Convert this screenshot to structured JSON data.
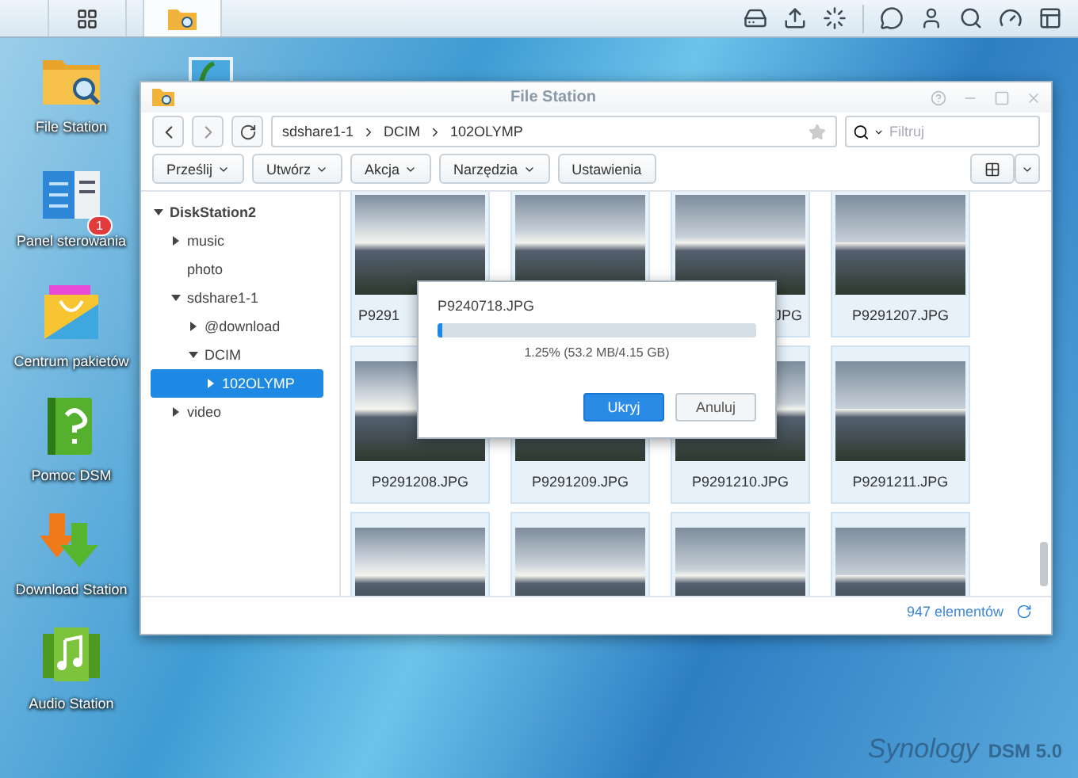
{
  "taskbar": {
    "apps": [
      {
        "kind": "main_menu",
        "selected": false
      },
      {
        "kind": "file_station",
        "selected": true
      }
    ]
  },
  "desktop_icons": [
    {
      "kind": "folder",
      "label": "File Station"
    },
    {
      "kind": "control_panel",
      "label": "Panel sterowania",
      "badge": "1"
    },
    {
      "kind": "package",
      "label": "Centrum pakietów"
    },
    {
      "kind": "help",
      "label": "Pomoc DSM"
    },
    {
      "kind": "download",
      "label": "Download Station"
    },
    {
      "kind": "audio",
      "label": "Audio Station"
    }
  ],
  "window": {
    "title": "File Station",
    "path": [
      "sdshare1-1",
      "DCIM",
      "102OLYMP"
    ],
    "search": {
      "placeholder": "Filtruj"
    },
    "toolbar": [
      {
        "label": "Prześlij",
        "dropdown": true
      },
      {
        "label": "Utwórz",
        "dropdown": true
      },
      {
        "label": "Akcja",
        "dropdown": true
      },
      {
        "label": "Narzędzia",
        "dropdown": true
      },
      {
        "label": "Ustawienia",
        "dropdown": false
      }
    ],
    "tree": [
      {
        "label": "DiskStation2",
        "kind": "branch",
        "expanded": true,
        "selected": false,
        "children": [
          {
            "label": "music",
            "kind": "branch",
            "expanded": false,
            "selected": false
          },
          {
            "label": "photo",
            "kind": "leaf",
            "expanded": false,
            "selected": false
          },
          {
            "label": "sdshare1-1",
            "kind": "branch",
            "expanded": true,
            "selected": false,
            "children": [
              {
                "label": "@download",
                "kind": "branch",
                "expanded": false,
                "selected": false
              },
              {
                "label": "DCIM",
                "kind": "branch",
                "expanded": true,
                "selected": false,
                "children": [
                  {
                    "label": "102OLYMP",
                    "kind": "branch",
                    "expanded": false,
                    "selected": true
                  }
                ]
              }
            ]
          },
          {
            "label": "video",
            "kind": "branch",
            "expanded": false,
            "selected": false
          }
        ]
      }
    ],
    "files": [
      {
        "kind": "start",
        "label": "P9291"
      },
      {
        "kind": "none"
      },
      {
        "kind": "end",
        "label": "JPG"
      },
      {
        "kind": "full",
        "label": "P9291207.JPG"
      },
      {
        "kind": "full",
        "label": "P9291208.JPG"
      },
      {
        "kind": "full",
        "label": "P9291209.JPG"
      },
      {
        "kind": "full",
        "label": "P9291210.JPG"
      },
      {
        "kind": "full",
        "label": "P9291211.JPG"
      },
      {
        "kind": "none"
      },
      {
        "kind": "none"
      },
      {
        "kind": "none"
      },
      {
        "kind": "none"
      }
    ],
    "status": "947 elementów",
    "dialog": {
      "file": "P9240718.JPG",
      "level": 0.0125,
      "reading": "1.25% (53.2 MB/4.15 GB)",
      "buttons": [
        {
          "label": "Ukryj",
          "primary": true
        },
        {
          "label": "Anuluj",
          "primary": false
        }
      ]
    }
  },
  "brand": {
    "name": "Synology",
    "version": "DSM 5.0"
  }
}
